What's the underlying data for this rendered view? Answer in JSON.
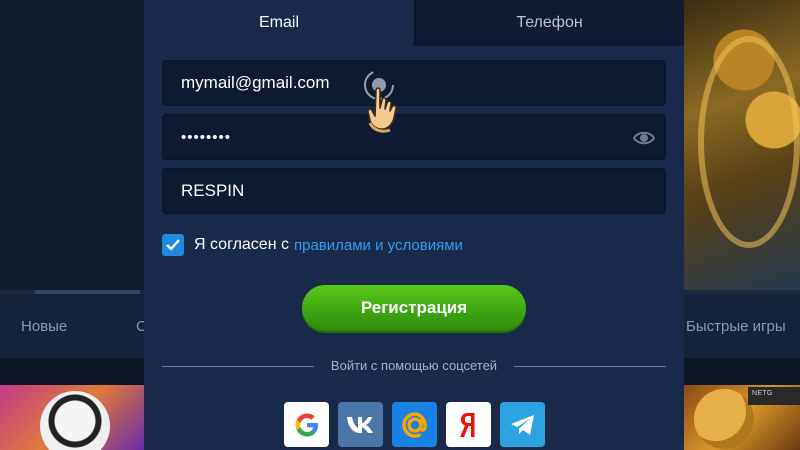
{
  "background": {
    "nav_items": [
      "Новые",
      "С",
      "Быстрые игры"
    ],
    "brand_badge": "NETG"
  },
  "modal": {
    "tabs": [
      {
        "label": "Email",
        "active": true
      },
      {
        "label": "Телефон",
        "active": false
      }
    ],
    "email_value": "mymail@gmail.com",
    "password_value": "••••••••",
    "promo_value": "RESPIN",
    "agree_checked": true,
    "agree_text": "Я согласен с",
    "agree_link": "правилами и условиями",
    "register_label": "Регистрация",
    "social_divider": "Войти с помощью соцсетей",
    "social_icons": [
      "google-icon",
      "vk-icon",
      "mail-ru-icon",
      "yandex-icon",
      "telegram-icon"
    ]
  },
  "colors": {
    "accent_blue": "#1e8ae0",
    "link_blue": "#2f9cf2",
    "register_green": "#3fa712",
    "modal_bg": "#18294a"
  }
}
